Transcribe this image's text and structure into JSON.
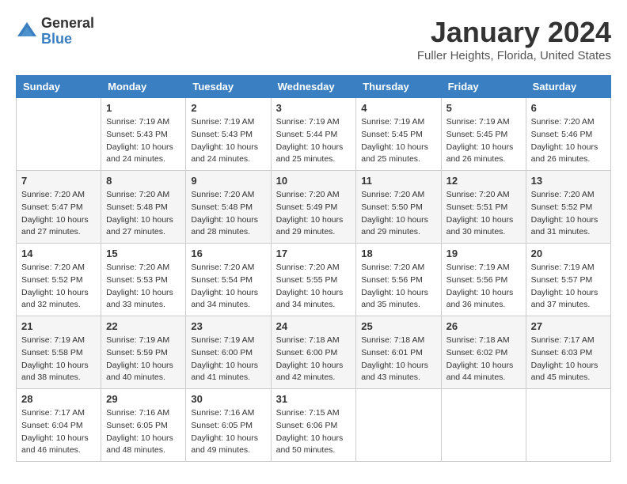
{
  "app": {
    "logo_general": "General",
    "logo_blue": "Blue"
  },
  "header": {
    "month": "January 2024",
    "location": "Fuller Heights, Florida, United States"
  },
  "weekdays": [
    "Sunday",
    "Monday",
    "Tuesday",
    "Wednesday",
    "Thursday",
    "Friday",
    "Saturday"
  ],
  "weeks": [
    [
      {
        "day": "",
        "sunrise": "",
        "sunset": "",
        "daylight": ""
      },
      {
        "day": "1",
        "sunrise": "Sunrise: 7:19 AM",
        "sunset": "Sunset: 5:43 PM",
        "daylight": "Daylight: 10 hours and 24 minutes."
      },
      {
        "day": "2",
        "sunrise": "Sunrise: 7:19 AM",
        "sunset": "Sunset: 5:43 PM",
        "daylight": "Daylight: 10 hours and 24 minutes."
      },
      {
        "day": "3",
        "sunrise": "Sunrise: 7:19 AM",
        "sunset": "Sunset: 5:44 PM",
        "daylight": "Daylight: 10 hours and 25 minutes."
      },
      {
        "day": "4",
        "sunrise": "Sunrise: 7:19 AM",
        "sunset": "Sunset: 5:45 PM",
        "daylight": "Daylight: 10 hours and 25 minutes."
      },
      {
        "day": "5",
        "sunrise": "Sunrise: 7:19 AM",
        "sunset": "Sunset: 5:45 PM",
        "daylight": "Daylight: 10 hours and 26 minutes."
      },
      {
        "day": "6",
        "sunrise": "Sunrise: 7:20 AM",
        "sunset": "Sunset: 5:46 PM",
        "daylight": "Daylight: 10 hours and 26 minutes."
      }
    ],
    [
      {
        "day": "7",
        "sunrise": "Sunrise: 7:20 AM",
        "sunset": "Sunset: 5:47 PM",
        "daylight": "Daylight: 10 hours and 27 minutes."
      },
      {
        "day": "8",
        "sunrise": "Sunrise: 7:20 AM",
        "sunset": "Sunset: 5:48 PM",
        "daylight": "Daylight: 10 hours and 27 minutes."
      },
      {
        "day": "9",
        "sunrise": "Sunrise: 7:20 AM",
        "sunset": "Sunset: 5:48 PM",
        "daylight": "Daylight: 10 hours and 28 minutes."
      },
      {
        "day": "10",
        "sunrise": "Sunrise: 7:20 AM",
        "sunset": "Sunset: 5:49 PM",
        "daylight": "Daylight: 10 hours and 29 minutes."
      },
      {
        "day": "11",
        "sunrise": "Sunrise: 7:20 AM",
        "sunset": "Sunset: 5:50 PM",
        "daylight": "Daylight: 10 hours and 29 minutes."
      },
      {
        "day": "12",
        "sunrise": "Sunrise: 7:20 AM",
        "sunset": "Sunset: 5:51 PM",
        "daylight": "Daylight: 10 hours and 30 minutes."
      },
      {
        "day": "13",
        "sunrise": "Sunrise: 7:20 AM",
        "sunset": "Sunset: 5:52 PM",
        "daylight": "Daylight: 10 hours and 31 minutes."
      }
    ],
    [
      {
        "day": "14",
        "sunrise": "Sunrise: 7:20 AM",
        "sunset": "Sunset: 5:52 PM",
        "daylight": "Daylight: 10 hours and 32 minutes."
      },
      {
        "day": "15",
        "sunrise": "Sunrise: 7:20 AM",
        "sunset": "Sunset: 5:53 PM",
        "daylight": "Daylight: 10 hours and 33 minutes."
      },
      {
        "day": "16",
        "sunrise": "Sunrise: 7:20 AM",
        "sunset": "Sunset: 5:54 PM",
        "daylight": "Daylight: 10 hours and 34 minutes."
      },
      {
        "day": "17",
        "sunrise": "Sunrise: 7:20 AM",
        "sunset": "Sunset: 5:55 PM",
        "daylight": "Daylight: 10 hours and 34 minutes."
      },
      {
        "day": "18",
        "sunrise": "Sunrise: 7:20 AM",
        "sunset": "Sunset: 5:56 PM",
        "daylight": "Daylight: 10 hours and 35 minutes."
      },
      {
        "day": "19",
        "sunrise": "Sunrise: 7:19 AM",
        "sunset": "Sunset: 5:56 PM",
        "daylight": "Daylight: 10 hours and 36 minutes."
      },
      {
        "day": "20",
        "sunrise": "Sunrise: 7:19 AM",
        "sunset": "Sunset: 5:57 PM",
        "daylight": "Daylight: 10 hours and 37 minutes."
      }
    ],
    [
      {
        "day": "21",
        "sunrise": "Sunrise: 7:19 AM",
        "sunset": "Sunset: 5:58 PM",
        "daylight": "Daylight: 10 hours and 38 minutes."
      },
      {
        "day": "22",
        "sunrise": "Sunrise: 7:19 AM",
        "sunset": "Sunset: 5:59 PM",
        "daylight": "Daylight: 10 hours and 40 minutes."
      },
      {
        "day": "23",
        "sunrise": "Sunrise: 7:19 AM",
        "sunset": "Sunset: 6:00 PM",
        "daylight": "Daylight: 10 hours and 41 minutes."
      },
      {
        "day": "24",
        "sunrise": "Sunrise: 7:18 AM",
        "sunset": "Sunset: 6:00 PM",
        "daylight": "Daylight: 10 hours and 42 minutes."
      },
      {
        "day": "25",
        "sunrise": "Sunrise: 7:18 AM",
        "sunset": "Sunset: 6:01 PM",
        "daylight": "Daylight: 10 hours and 43 minutes."
      },
      {
        "day": "26",
        "sunrise": "Sunrise: 7:18 AM",
        "sunset": "Sunset: 6:02 PM",
        "daylight": "Daylight: 10 hours and 44 minutes."
      },
      {
        "day": "27",
        "sunrise": "Sunrise: 7:17 AM",
        "sunset": "Sunset: 6:03 PM",
        "daylight": "Daylight: 10 hours and 45 minutes."
      }
    ],
    [
      {
        "day": "28",
        "sunrise": "Sunrise: 7:17 AM",
        "sunset": "Sunset: 6:04 PM",
        "daylight": "Daylight: 10 hours and 46 minutes."
      },
      {
        "day": "29",
        "sunrise": "Sunrise: 7:16 AM",
        "sunset": "Sunset: 6:05 PM",
        "daylight": "Daylight: 10 hours and 48 minutes."
      },
      {
        "day": "30",
        "sunrise": "Sunrise: 7:16 AM",
        "sunset": "Sunset: 6:05 PM",
        "daylight": "Daylight: 10 hours and 49 minutes."
      },
      {
        "day": "31",
        "sunrise": "Sunrise: 7:15 AM",
        "sunset": "Sunset: 6:06 PM",
        "daylight": "Daylight: 10 hours and 50 minutes."
      },
      {
        "day": "",
        "sunrise": "",
        "sunset": "",
        "daylight": ""
      },
      {
        "day": "",
        "sunrise": "",
        "sunset": "",
        "daylight": ""
      },
      {
        "day": "",
        "sunrise": "",
        "sunset": "",
        "daylight": ""
      }
    ]
  ]
}
